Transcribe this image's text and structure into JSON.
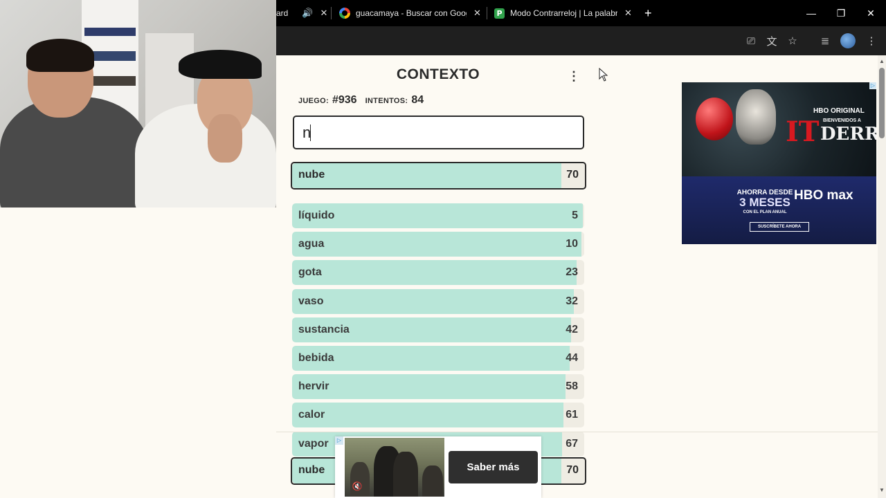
{
  "browser": {
    "tabs": [
      {
        "title": "ard",
        "audio_icon": "speaker-icon"
      },
      {
        "title": "guacamaya - Buscar con Googl",
        "favicon": "google-icon"
      },
      {
        "title": "Modo Contrarreloj | La palabra",
        "favicon": "p-icon",
        "favicon_letter": "P"
      }
    ],
    "new_tab_label": "+",
    "toolbar_icons": [
      "install-app-icon",
      "translate-icon",
      "bookmark-star-icon",
      "media-control-icon",
      "profile-avatar-icon",
      "kebab-menu-icon"
    ]
  },
  "game": {
    "title": "CONTEXTO",
    "stats": {
      "game_label": "JUEGO:",
      "game_value": "#936",
      "attempts_label": "INTENTOS:",
      "attempts_value": "84"
    },
    "input_value": "n",
    "current_guess": {
      "word": "nube",
      "rank": 70,
      "progress": 0.92
    },
    "guesses": [
      {
        "word": "líquido",
        "rank": 5,
        "progress": 0.995
      },
      {
        "word": "agua",
        "rank": 10,
        "progress": 0.99
      },
      {
        "word": "gota",
        "rank": 23,
        "progress": 0.975
      },
      {
        "word": "vaso",
        "rank": 32,
        "progress": 0.965
      },
      {
        "word": "sustancia",
        "rank": 42,
        "progress": 0.955
      },
      {
        "word": "bebida",
        "rank": 44,
        "progress": 0.95
      },
      {
        "word": "hervir",
        "rank": 58,
        "progress": 0.935
      },
      {
        "word": "calor",
        "rank": 61,
        "progress": 0.93
      },
      {
        "word": "vapor",
        "rank": 67,
        "progress": 0.925
      },
      {
        "word": "nube",
        "rank": 70,
        "progress": 0.92,
        "highlight": true
      }
    ]
  },
  "ads": {
    "right": {
      "brand_top": "HBO ORIGINAL",
      "title_it": "IT",
      "title_derry": "DERRY",
      "subtitle": "BIENVENIDOS A",
      "offer_line1": "AHORRA DESDE",
      "offer_line2": "3 MESES",
      "offer_line3": "CON EL PLAN ANUAL",
      "logo": "HBO max",
      "cta": "SUSCRÍBETE AHORA"
    },
    "bottom": {
      "cta": "Saber más"
    }
  }
}
